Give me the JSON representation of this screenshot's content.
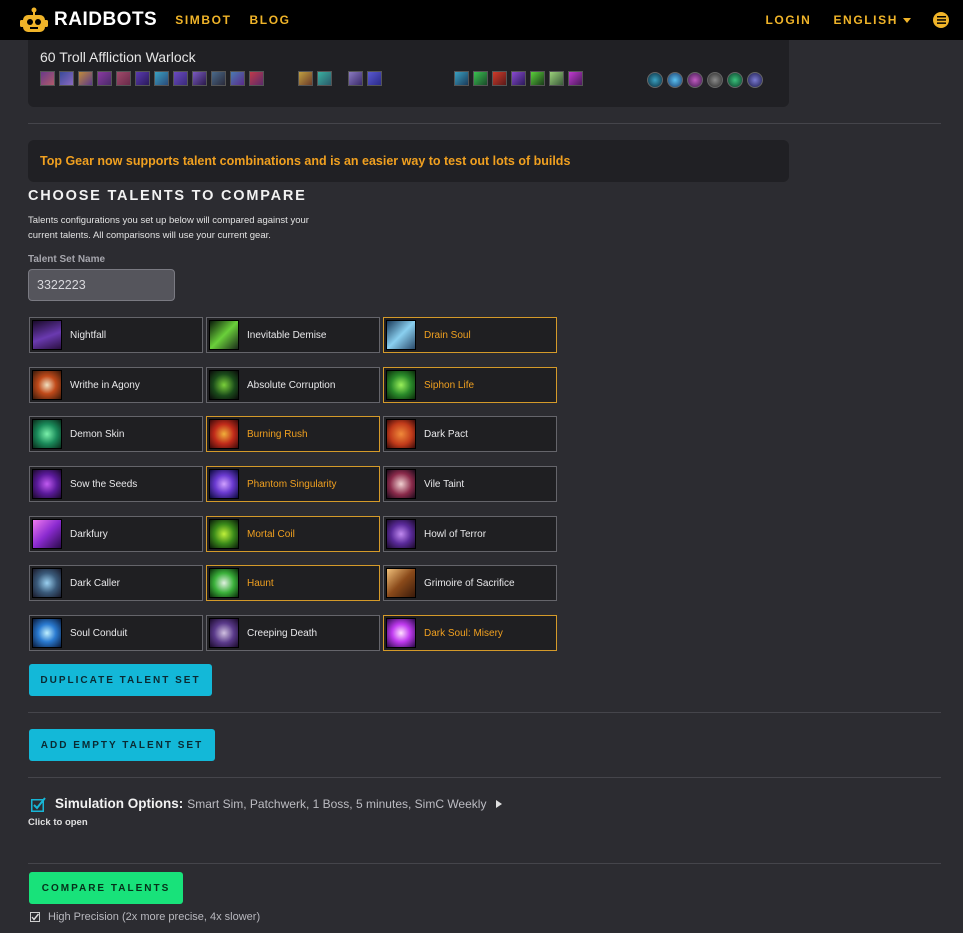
{
  "nav": {
    "logo": "RAIDBOTS",
    "links": [
      "SIMBOT",
      "BLOG"
    ],
    "login": "LOGIN",
    "language": "ENGLISH"
  },
  "character": {
    "name": "60 Troll Affliction Warlock"
  },
  "banner": "Top Gear now supports talent combinations and is an easier way to test out lots of builds",
  "section": {
    "title": "CHOOSE TALENTS TO COMPARE",
    "description": "Talents configurations you set up below will compared against your current talents. All comparisons will use your current gear.",
    "field_label": "Talent Set Name",
    "field_value": "3322223"
  },
  "talents": [
    {
      "name": "Nightfall",
      "selected": false
    },
    {
      "name": "Inevitable Demise",
      "selected": false
    },
    {
      "name": "Drain Soul",
      "selected": true
    },
    {
      "name": "Writhe in Agony",
      "selected": false
    },
    {
      "name": "Absolute Corruption",
      "selected": false
    },
    {
      "name": "Siphon Life",
      "selected": true
    },
    {
      "name": "Demon Skin",
      "selected": false
    },
    {
      "name": "Burning Rush",
      "selected": true
    },
    {
      "name": "Dark Pact",
      "selected": false
    },
    {
      "name": "Sow the Seeds",
      "selected": false
    },
    {
      "name": "Phantom Singularity",
      "selected": true
    },
    {
      "name": "Vile Taint",
      "selected": false
    },
    {
      "name": "Darkfury",
      "selected": false
    },
    {
      "name": "Mortal Coil",
      "selected": true
    },
    {
      "name": "Howl of Terror",
      "selected": false
    },
    {
      "name": "Dark Caller",
      "selected": false
    },
    {
      "name": "Haunt",
      "selected": true
    },
    {
      "name": "Grimoire of Sacrifice",
      "selected": false
    },
    {
      "name": "Soul Conduit",
      "selected": false
    },
    {
      "name": "Creeping Death",
      "selected": false
    },
    {
      "name": "Dark Soul: Misery",
      "selected": true
    }
  ],
  "buttons": {
    "duplicate": "DUPLICATE TALENT SET",
    "add_empty": "ADD EMPTY TALENT SET",
    "compare": "COMPARE TALENTS"
  },
  "sim_options": {
    "title": "Simulation Options:",
    "value": "Smart Sim, Patchwerk, 1 Boss, 5 minutes, SimC Weekly",
    "hint": "Click to open"
  },
  "high_precision": "High Precision (2x more precise, 4x slower)",
  "colors": {
    "accent": "#f0b429",
    "selected_border": "#d49a2a",
    "button_cyan": "#13b8d8",
    "button_green": "#18e27a"
  }
}
